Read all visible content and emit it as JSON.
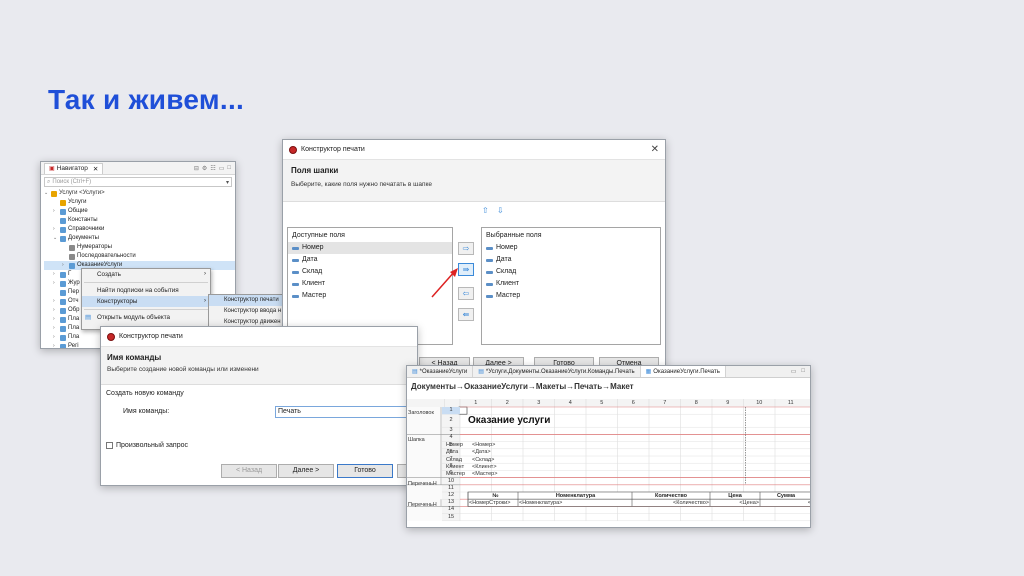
{
  "slide": {
    "title": "Так и живем..."
  },
  "navigator": {
    "tab_label": "Навигатор",
    "search_placeholder": "Поиск (Ctrl+F)",
    "tree": [
      {
        "label": "Услуги <Услуги>",
        "indent": 0,
        "color": "#e8a400",
        "twisty": "v",
        "accent": true
      },
      {
        "label": "Услуги",
        "indent": 1,
        "color": "#e8a400",
        "twisty": ""
      },
      {
        "label": "Общие",
        "indent": 1,
        "color": "#5b9bd5",
        "twisty": ">"
      },
      {
        "label": "Константы",
        "indent": 1,
        "color": "#5b9bd5",
        "twisty": ""
      },
      {
        "label": "Справочники",
        "indent": 1,
        "color": "#5b9bd5",
        "twisty": ">"
      },
      {
        "label": "Документы",
        "indent": 1,
        "color": "#5b9bd5",
        "twisty": "v"
      },
      {
        "label": "Нумераторы",
        "indent": 2,
        "color": "#8a8a8a",
        "twisty": ""
      },
      {
        "label": "Последовательности",
        "indent": 2,
        "color": "#8a8a8a",
        "twisty": ""
      },
      {
        "label": "ОказаниеУслуги",
        "indent": 2,
        "color": "#5b9bd5",
        "twisty": ">",
        "selected": true
      },
      {
        "label": "Г",
        "indent": 1,
        "color": "#5b9bd5",
        "twisty": ">"
      },
      {
        "label": "Жур",
        "indent": 1,
        "color": "#5b9bd5",
        "twisty": ">"
      },
      {
        "label": "Пер",
        "indent": 1,
        "color": "#5b9bd5",
        "twisty": ""
      },
      {
        "label": "Отч",
        "indent": 1,
        "color": "#5b9bd5",
        "twisty": ">"
      },
      {
        "label": "Обр",
        "indent": 1,
        "color": "#5b9bd5",
        "twisty": ">"
      },
      {
        "label": "Пла",
        "indent": 1,
        "color": "#5b9bd5",
        "twisty": ">"
      },
      {
        "label": "Пла",
        "indent": 1,
        "color": "#5b9bd5",
        "twisty": ">"
      },
      {
        "label": "Пла",
        "indent": 1,
        "color": "#5b9bd5",
        "twisty": ">"
      },
      {
        "label": "Регі",
        "indent": 1,
        "color": "#5b9bd5",
        "twisty": ">"
      }
    ]
  },
  "context_menu": {
    "items": [
      "Создать",
      "Найти подписки на события",
      "Конструкторы",
      "Открыть модуль объекта"
    ],
    "submenu": [
      "Конструктор печати",
      "Конструктор ввода н",
      "Конструктор движен"
    ]
  },
  "print_constructor": {
    "title": "Конструктор печати",
    "section_title": "Поля шапки",
    "section_subtitle": "Выберите, какие поля нужно печатать в шапке",
    "available_title": "Доступные поля",
    "available": [
      "Номер",
      "Дата",
      "Склад",
      "Клиент",
      "Мастер"
    ],
    "selected_title": "Выбранные поля",
    "selected": [
      "Номер",
      "Дата",
      "Склад",
      "Клиент",
      "Мастер"
    ],
    "buttons": {
      "back": "< Назад",
      "next": "Далее >",
      "done": "Готово",
      "cancel": "Отмена"
    }
  },
  "command_dialog": {
    "title": "Конструктор печати",
    "section_title": "Имя команды",
    "section_subtitle": "Выберите создание новой команды или изменени",
    "create_label": "Создать новую команду",
    "name_label": "Имя команды:",
    "name_value": "Печать",
    "checkbox_label": "Произвольный запрос",
    "buttons": {
      "back": "< Назад",
      "next": "Далее >",
      "done": "Готово"
    }
  },
  "layout_editor": {
    "tabs": [
      "*ОказаниеУслуги",
      "*Услуги.Документы.ОказаниеУслуги.Команды.Печать",
      "ОказаниеУслуги.Печать"
    ],
    "breadcrumb": "Документы→ОказаниеУслуги→Макеты→Печать→Макет",
    "columns": [
      "1",
      "2",
      "3",
      "4",
      "5",
      "6",
      "7",
      "8",
      "9",
      "10",
      "11"
    ],
    "rows": [
      "1",
      "2",
      "3",
      "4",
      "5",
      "6",
      "7",
      "8",
      "9",
      "10",
      "11",
      "12",
      "13",
      "14",
      "15"
    ],
    "areas": [
      {
        "label": "Заголовок",
        "row": 1
      },
      {
        "label": "Шапка",
        "row": 4
      },
      {
        "label": "ПереченьН",
        "row": 10
      },
      {
        "label": "ПереченьН",
        "row": 13
      }
    ],
    "doc_title": "Оказание услуги",
    "header_fields": [
      {
        "label": "Номер",
        "param": "<Номер>"
      },
      {
        "label": "Дата",
        "param": "<Дата>"
      },
      {
        "label": "Склад",
        "param": "<Склад>"
      },
      {
        "label": "Клиент",
        "param": "<Клиент>"
      },
      {
        "label": "Мастер",
        "param": "<Мастер>"
      }
    ],
    "table_headers": [
      "№",
      "Номенклатура",
      "Количество",
      "Цена",
      "Сумма"
    ],
    "table_params": [
      "<НомерСтроки>",
      "<Номенклатура>",
      "<Количество>",
      "<Цена>",
      "<"
    ]
  }
}
